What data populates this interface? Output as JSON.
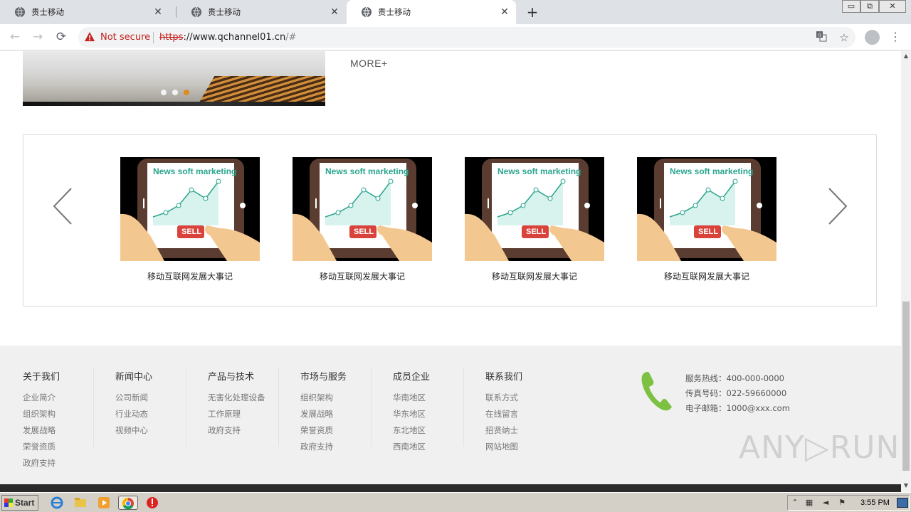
{
  "browser": {
    "tabs": [
      {
        "title": "贵士移动"
      },
      {
        "title": "贵士移动"
      },
      {
        "title": "贵士移动"
      }
    ],
    "new_tab_label": "+",
    "nav": {
      "back": "←",
      "forward": "→",
      "reload": "⟳"
    },
    "security_label": "Not secure",
    "url": {
      "scheme": "https",
      "host": "://www.qchannel01.cn",
      "path": "/#"
    },
    "window_controls": {
      "minimize": "▭",
      "restore": "⧉",
      "close": "✕"
    }
  },
  "page": {
    "banner": {
      "dots": [
        false,
        false,
        true
      ]
    },
    "more_link": "MORE+",
    "carousel": {
      "cards": [
        {
          "image_title": "News soft marketing",
          "button": "SELL",
          "caption": "移动互联网发展大事记"
        },
        {
          "image_title": "News soft marketing",
          "button": "SELL",
          "caption": "移动互联网发展大事记"
        },
        {
          "image_title": "News soft marketing",
          "button": "SELL",
          "caption": "移动互联网发展大事记"
        },
        {
          "image_title": "News soft marketing",
          "button": "SELL",
          "caption": "移动互联网发展大事记"
        }
      ]
    },
    "footer": {
      "columns": [
        {
          "heading": "关于我们",
          "items": [
            "企业简介",
            "组织架构",
            "发展战略",
            "荣誉资质",
            "政府支持"
          ]
        },
        {
          "heading": "新闻中心",
          "items": [
            "公司新闻",
            "行业动态",
            "视频中心"
          ]
        },
        {
          "heading": "产品与技术",
          "items": [
            "无害化处理设备",
            "工作原理",
            "政府支持"
          ]
        },
        {
          "heading": "市场与服务",
          "items": [
            "组织架构",
            "发展战略",
            "荣誉资质",
            "政府支持"
          ]
        },
        {
          "heading": "成员企业",
          "items": [
            "华南地区",
            "华东地区",
            "东北地区",
            "西南地区"
          ]
        },
        {
          "heading": "联系我们",
          "items": [
            "联系方式",
            "在线留言",
            "招贤纳士",
            "网站地图"
          ]
        }
      ],
      "contact": {
        "hotline": "服务热线：400-000-0000",
        "fax": "传真号码：022-59660000",
        "email": "电子邮箱：1000@xxx.com"
      },
      "watermark": "ANY▷RUN"
    }
  },
  "taskbar": {
    "start_label": "Start",
    "clock": "3:55 PM"
  },
  "colors": {
    "accent_dot": "#e08a1e",
    "warning_red": "#c5221f",
    "footer_bg": "#f0f0f0",
    "phone_green": "#7cc142"
  }
}
